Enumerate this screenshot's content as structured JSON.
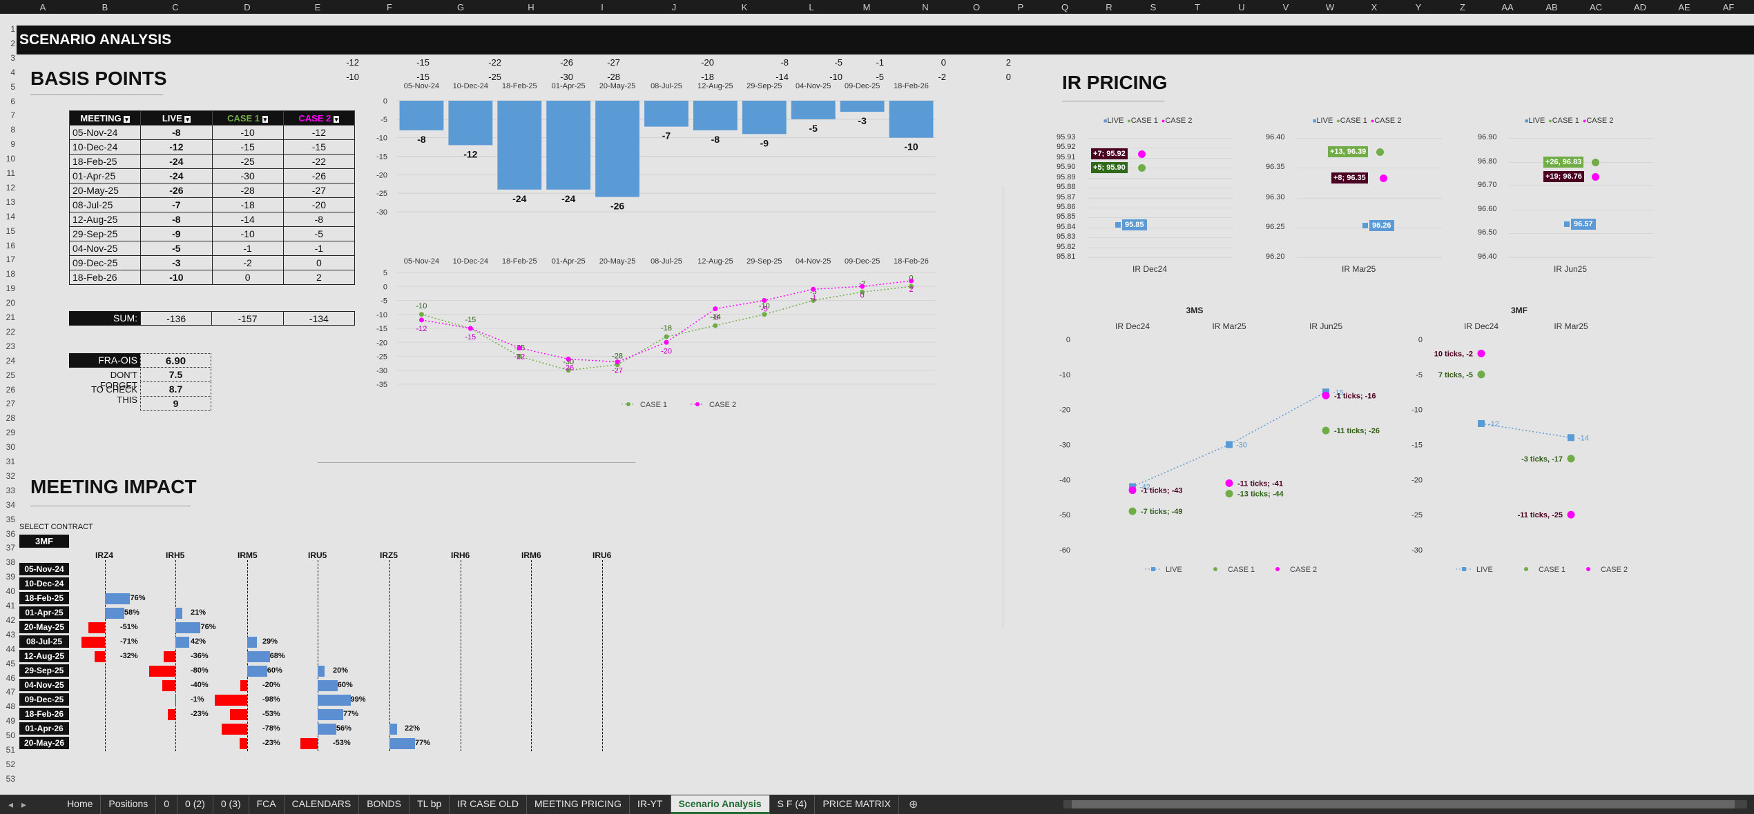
{
  "sheet": {
    "title": "SCENARIO ANALYSIS",
    "cols": [
      "A",
      "B",
      "C",
      "D",
      "E",
      "F",
      "G",
      "H",
      "I",
      "J",
      "K",
      "L",
      "M",
      "N",
      "O",
      "P",
      "Q",
      "R",
      "S",
      "T",
      "U",
      "V",
      "W",
      "X",
      "Y",
      "Z",
      "AA",
      "AB",
      "AC",
      "AD",
      "AE",
      "AF"
    ]
  },
  "bp": {
    "title": "BASIS POINTS",
    "headers": [
      "MEETING",
      "LIVE",
      "CASE 1",
      "CASE 2"
    ],
    "rows": [
      [
        "05-Nov-24",
        "-8",
        "-10",
        "-12"
      ],
      [
        "10-Dec-24",
        "-12",
        "-15",
        "-15"
      ],
      [
        "18-Feb-25",
        "-24",
        "-25",
        "-22"
      ],
      [
        "01-Apr-25",
        "-24",
        "-30",
        "-26"
      ],
      [
        "20-May-25",
        "-26",
        "-28",
        "-27"
      ],
      [
        "08-Jul-25",
        "-7",
        "-18",
        "-20"
      ],
      [
        "12-Aug-25",
        "-8",
        "-14",
        "-8"
      ],
      [
        "29-Sep-25",
        "-9",
        "-10",
        "-5"
      ],
      [
        "04-Nov-25",
        "-5",
        "-1",
        "-1"
      ],
      [
        "09-Dec-25",
        "-3",
        "-2",
        "0"
      ],
      [
        "18-Feb-26",
        "-10",
        "0",
        "2"
      ]
    ],
    "sum_label": "SUM:",
    "sums": [
      "-136",
      "-157",
      "-134"
    ],
    "fra_label": "FRA-OIS",
    "fra_value": "6.90",
    "notes": [
      [
        "DON'T FORGET",
        "7.5"
      ],
      [
        "TO CHECK THIS",
        "8.7"
      ],
      [
        "",
        "9"
      ]
    ],
    "top_row2": [
      "-12",
      "-15",
      "-22",
      "-26",
      "-27",
      "-20",
      "-8",
      "-5",
      "-1",
      "0",
      "2"
    ],
    "top_row3": [
      "-10",
      "-15",
      "-25",
      "-30",
      "-28",
      "-18",
      "-14",
      "-10",
      "-5",
      "-2",
      "0"
    ]
  },
  "chart_data": [
    {
      "type": "bar",
      "title": "",
      "categories": [
        "05-Nov-24",
        "10-Dec-24",
        "18-Feb-25",
        "01-Apr-25",
        "20-May-25",
        "08-Jul-25",
        "12-Aug-25",
        "29-Sep-25",
        "04-Nov-25",
        "09-Dec-25",
        "18-Feb-26"
      ],
      "values": [
        -8,
        -12,
        -24,
        -24,
        -26,
        -7,
        -8,
        -9,
        -5,
        -3,
        -10
      ],
      "ylim": [
        -30,
        0
      ],
      "yticks": [
        "0",
        "-5",
        "-10",
        "-15",
        "-20",
        "-25",
        "-30"
      ]
    },
    {
      "type": "line",
      "categories": [
        "05-Nov-24",
        "10-Dec-24",
        "18-Feb-25",
        "01-Apr-25",
        "20-May-25",
        "08-Jul-25",
        "12-Aug-25",
        "29-Sep-25",
        "04-Nov-25",
        "09-Dec-25",
        "18-Feb-26"
      ],
      "series": [
        {
          "name": "CASE 1",
          "values": [
            -10,
            -15,
            -25,
            -30,
            -28,
            -18,
            -14,
            -10,
            -5,
            -2,
            0
          ],
          "color": "#70ad47"
        },
        {
          "name": "CASE 2",
          "values": [
            -12,
            -15,
            -22,
            -26,
            -27,
            -20,
            -8,
            -5,
            -1,
            0,
            2
          ],
          "color": "#ff00ff"
        }
      ],
      "ylim": [
        -35,
        5
      ],
      "yticks": [
        "5",
        "0",
        "-5",
        "-10",
        "-15",
        "-20",
        "-25",
        "-30",
        "-35"
      ]
    }
  ],
  "ir": {
    "title": "IR PRICING",
    "legend": [
      "LIVE",
      "CASE 1",
      "CASE 2"
    ],
    "panels": [
      {
        "x": "IR Dec24",
        "yticks": [
          "95.93",
          "95.92",
          "95.91",
          "95.90",
          "95.89",
          "95.88",
          "95.87",
          "95.86",
          "95.85",
          "95.84",
          "95.83",
          "95.82",
          "95.81"
        ],
        "c2": "+7; 95.92",
        "c1": "+5; 95.90",
        "live": "95.85"
      },
      {
        "x": "IR Mar25",
        "yticks": [
          "96.40",
          "96.35",
          "96.30",
          "96.25",
          "96.20"
        ],
        "c1": "+13, 96.39",
        "c2": "+8; 96.35",
        "live": "96.26"
      },
      {
        "x": "IR Jun25",
        "yticks": [
          "96.90",
          "96.80",
          "96.70",
          "96.60",
          "96.50",
          "96.40"
        ],
        "c1": "+26, 96.83",
        "c2": "+19; 96.76",
        "live": "96.57"
      }
    ],
    "ms": {
      "title": "3MS",
      "cats": [
        "IR Dec24",
        "IR Mar25",
        "IR Jun25"
      ],
      "yticks": [
        "0",
        "-10",
        "-20",
        "-30",
        "-40",
        "-50",
        "-60"
      ],
      "live": [
        "-42",
        "-30",
        "-15"
      ],
      "labels": [
        [
          "-1 ticks; -43",
          "-7 ticks; -49"
        ],
        [
          "-11 ticks; -41",
          "-13 ticks; -44"
        ],
        [
          "-1 ticks; -16",
          "-11 ticks; -26"
        ]
      ]
    },
    "mf": {
      "title": "3MF",
      "cats": [
        "IR Dec24",
        "IR Mar25"
      ],
      "yticks": [
        "0",
        "-5",
        "-10",
        "-15",
        "-20",
        "-25",
        "-30"
      ],
      "live": [
        "-12",
        "-14"
      ],
      "labels": [
        [
          "10 ticks, -2",
          "7 ticks, -5"
        ],
        [
          "-3 ticks, -17",
          "-11 ticks, -25"
        ]
      ]
    },
    "legend2": [
      "LIVE",
      "CASE 1",
      "CASE 2"
    ]
  },
  "mi": {
    "title": "MEETING IMPACT",
    "select_label": "SELECT CONTRACT",
    "select_value": "3MF",
    "contracts": [
      "IRZ4",
      "IRH5",
      "IRM5",
      "IRU5",
      "IRZ5",
      "IRH6",
      "IRM6",
      "IRU6"
    ],
    "dates": [
      "05-Nov-24",
      "10-Dec-24",
      "18-Feb-25",
      "01-Apr-25",
      "20-May-25",
      "08-Jul-25",
      "12-Aug-25",
      "29-Sep-25",
      "04-Nov-25",
      "09-Dec-25",
      "18-Feb-26",
      "01-Apr-26",
      "20-May-26"
    ]
  },
  "tabs": [
    "Home",
    "Positions",
    "0",
    "0 (2)",
    "0 (3)",
    "FCA",
    "CALENDARS",
    "BONDS",
    "TL bp",
    "IR CASE OLD",
    "MEETING PRICING",
    "IR-YT",
    "Scenario Analysis",
    "S F (4)",
    "PRICE MATRIX"
  ]
}
